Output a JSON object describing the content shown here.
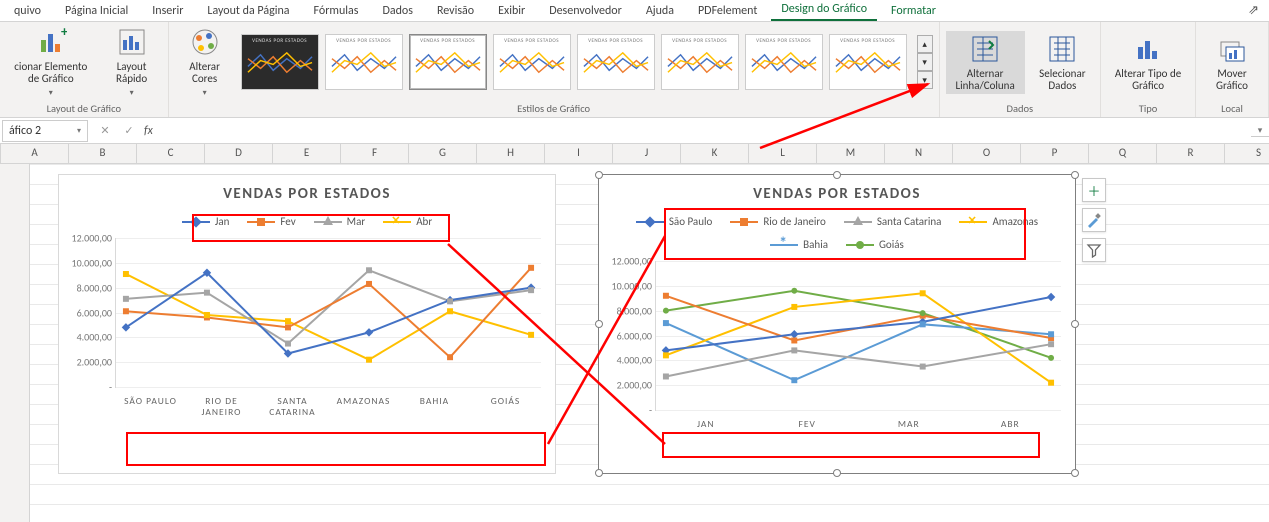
{
  "tabs": {
    "items": [
      "quivo",
      "Página Inicial",
      "Inserir",
      "Layout da Página",
      "Fórmulas",
      "Dados",
      "Revisão",
      "Exibir",
      "Desenvolvedor",
      "Ajuda",
      "PDFelement",
      "Design do Gráfico",
      "Formatar"
    ],
    "active_index": 11,
    "share_glyph": "⇗"
  },
  "ribbon": {
    "groups": {
      "layout": {
        "label": "Layout de Gráfico",
        "btn_add_element": "cionar Elemento\nde Gráfico",
        "btn_quick_layout": "Layout\nRápido"
      },
      "styles": {
        "label": "Estilos de Gráfico",
        "btn_colors": "Alterar\nCores"
      },
      "data": {
        "label": "Dados",
        "btn_switch": "Alternar\nLinha/Coluna",
        "btn_select": "Selecionar\nDados"
      },
      "type": {
        "label": "Tipo",
        "btn_change_type": "Alterar Tipo\nde Gráfico"
      },
      "location": {
        "label": "Local",
        "btn_move": "Mover\nGráfico"
      }
    }
  },
  "formula_bar": {
    "name_box": "áfico 2",
    "fx": "fx"
  },
  "columns": [
    "A",
    "B",
    "C",
    "D",
    "E",
    "F",
    "G",
    "H",
    "I",
    "J",
    "K",
    "L",
    "M",
    "N",
    "O",
    "P",
    "Q",
    "R",
    "S"
  ],
  "chart_left": {
    "title": "VENDAS POR ESTADOS",
    "legend": [
      "Jan",
      "Fev",
      "Mar",
      "Abr"
    ],
    "yticks": [
      "12.000,00",
      "10.000,00",
      "8.000,00",
      "6.000,00",
      "4.000,00",
      "2.000,00",
      "-"
    ],
    "xticks": [
      "SÃO PAULO",
      "RIO DE\nJANEIRO",
      "SANTA\nCATARINA",
      "AMAZONAS",
      "BAHIA",
      "GOIÁS"
    ]
  },
  "chart_right": {
    "title": "VENDAS POR ESTADOS",
    "legend": [
      "São Paulo",
      "Rio de Janeiro",
      "Santa Catarina",
      "Amazonas",
      "Bahia",
      "Goiás"
    ],
    "yticks": [
      "12.000,00",
      "10.000,00",
      "8.000,00",
      "6.000,00",
      "4.000,00",
      "2.000,00",
      "-"
    ],
    "xticks": [
      "JAN",
      "FEV",
      "MAR",
      "ABR"
    ]
  },
  "chart_data": [
    {
      "type": "line",
      "title": "VENDAS POR ESTADOS",
      "ylabel": "",
      "xlabel": "",
      "ylim": [
        0,
        12000
      ],
      "categories": [
        "São Paulo",
        "Rio de Janeiro",
        "Santa Catarina",
        "Amazonas",
        "Bahia",
        "Goiás"
      ],
      "series": [
        {
          "name": "Jan",
          "color": "#4472C4",
          "values": [
            4800,
            9200,
            2700,
            4400,
            7000,
            8000
          ]
        },
        {
          "name": "Fev",
          "color": "#ED7D31",
          "values": [
            6100,
            5600,
            4800,
            8300,
            2400,
            9600
          ]
        },
        {
          "name": "Mar",
          "color": "#A5A5A5",
          "values": [
            7100,
            7600,
            3500,
            9400,
            6900,
            7800
          ]
        },
        {
          "name": "Abr",
          "color": "#FFC000",
          "values": [
            9100,
            5800,
            5300,
            2200,
            6100,
            4200
          ]
        }
      ]
    },
    {
      "type": "line",
      "title": "VENDAS POR ESTADOS",
      "ylabel": "",
      "xlabel": "",
      "ylim": [
        0,
        12000
      ],
      "categories": [
        "Jan",
        "Fev",
        "Mar",
        "Abr"
      ],
      "series": [
        {
          "name": "São Paulo",
          "color": "#4472C4",
          "values": [
            4800,
            6100,
            7100,
            9100
          ]
        },
        {
          "name": "Rio de Janeiro",
          "color": "#ED7D31",
          "values": [
            9200,
            5600,
            7600,
            5800
          ]
        },
        {
          "name": "Santa Catarina",
          "color": "#A5A5A5",
          "values": [
            2700,
            4800,
            3500,
            5300
          ]
        },
        {
          "name": "Amazonas",
          "color": "#FFC000",
          "values": [
            4400,
            8300,
            9400,
            2200
          ]
        },
        {
          "name": "Bahia",
          "color": "#5B9BD5",
          "values": [
            7000,
            2400,
            6900,
            6100
          ]
        },
        {
          "name": "Goiás",
          "color": "#70AD47",
          "values": [
            8000,
            9600,
            7800,
            4200
          ]
        }
      ]
    }
  ],
  "colors": {
    "series": [
      "#4472C4",
      "#ED7D31",
      "#A5A5A5",
      "#FFC000",
      "#5B9BD5",
      "#70AD47"
    ]
  }
}
